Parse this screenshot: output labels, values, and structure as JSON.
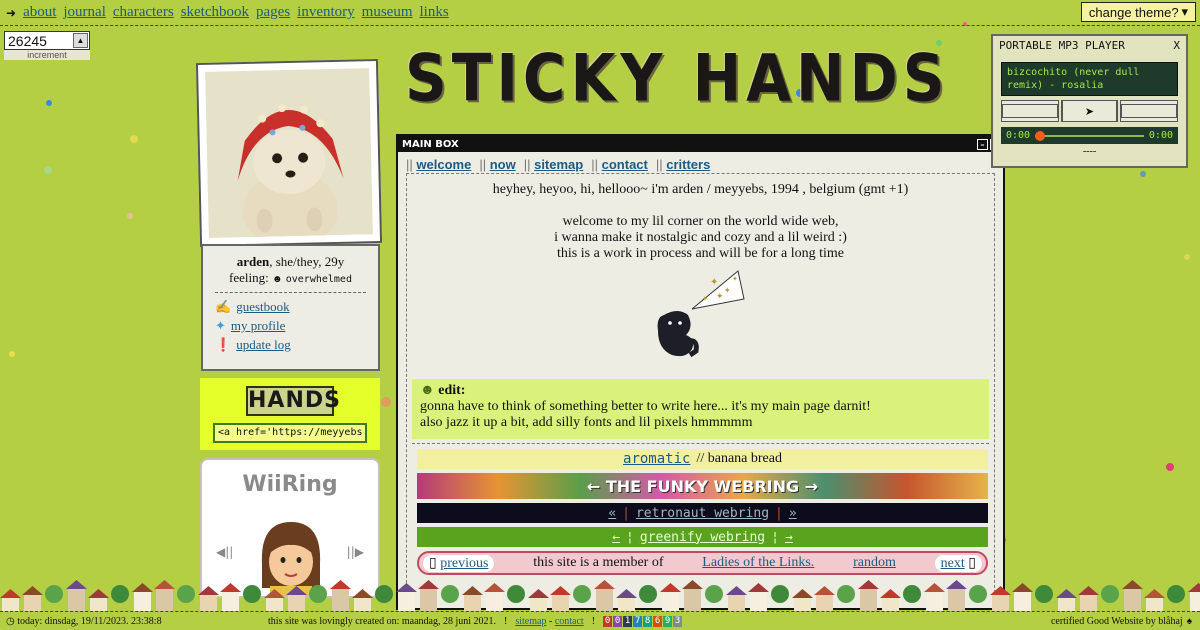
{
  "nav": {
    "arrow": "➜",
    "items": [
      "about",
      "journal",
      "characters",
      "sketchbook",
      "pages",
      "inventory",
      "museum",
      "links"
    ]
  },
  "theme_button": "change theme?",
  "counter": {
    "value": "26245",
    "label": "increment"
  },
  "title": "STICKY HANDS",
  "profile": {
    "name": "arden",
    "info": ", she/they, 29y",
    "feeling_label": "feeling:",
    "feeling_value": "overwhelmed",
    "links": [
      "guestbook",
      "my profile",
      "update log"
    ]
  },
  "hands_button": {
    "logo": "HANDS",
    "code": "<a href='https://meyyebs"
  },
  "wiiring": {
    "title": "WiiRing",
    "prev": "◀||",
    "next": "||▶"
  },
  "mainbox": {
    "title": "MAIN BOX",
    "tabs": [
      "welcome",
      "now",
      "sitemap",
      "contact",
      "critters"
    ],
    "intro_lines": [
      "heyhey, heyoo, hi, hellooo~ i'm arden / meyyebs, 1994 , belgium (gmt +1)",
      "",
      "welcome to my lil corner on the world wide web,",
      "i wanna make it nostalgic and cozy and a lil weird :)",
      "this is a work in process and will be for a long time"
    ],
    "edit_label": "edit:",
    "edit_lines": [
      "gonna have to think of something better to write here... it's my main page darnit!",
      "also jazz it up a bit, add silly fonts and lil pixels hmmmmm"
    ]
  },
  "webrings": {
    "aromatic_link": "aromatic",
    "aromatic_text": " // banana bread",
    "funky": "← THE FUNKY WEBRING →",
    "retronaut_prev": "«",
    "retronaut": "retronaut webring",
    "retronaut_next": "»",
    "greenify_prev": "←",
    "greenify": "greenify webring",
    "greenify_next": "→",
    "ladies_prev": "previous",
    "ladies_text": "this site is a member of",
    "ladies_link": "Ladies of the Links.",
    "ladies_random": "random",
    "ladies_next": "next"
  },
  "mp3": {
    "title": "PORTABLE MP3 PLAYER",
    "close": "X",
    "track": "bizcochito (never dull remix) - rosalia",
    "time_start": "0:00",
    "time_end": "0:00",
    "progress": 0,
    "status": "----"
  },
  "footer": {
    "today": "today: dinsdag, 19/11/2023. 23:38:8",
    "created": "this site was lovingly created on: maandag, 28 juni 2021.",
    "sitemap": "sitemap",
    "contact": "contact",
    "hits": [
      "0",
      "0",
      "1",
      "7",
      "8",
      "6",
      "9",
      "3"
    ],
    "certified": "certified Good Website by blåhaj"
  },
  "colors": {
    "background": "#b5cf45",
    "link": "#1c5a82",
    "edit_bg": "#d9f27c",
    "hands_bg": "#e5ff2a"
  }
}
